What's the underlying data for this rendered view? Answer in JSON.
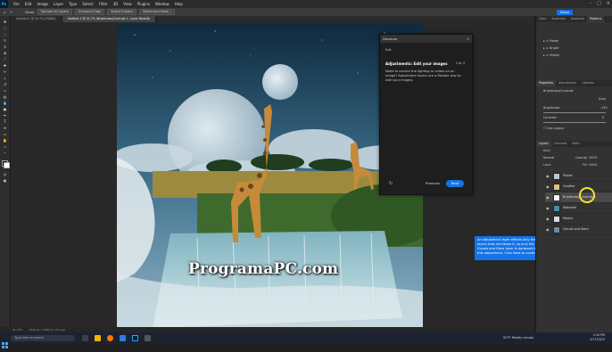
{
  "app": {
    "menu": [
      "File",
      "Edit",
      "Image",
      "Layer",
      "Type",
      "Select",
      "Filter",
      "3D",
      "View",
      "Plugins",
      "Window",
      "Help"
    ],
    "share_label": "Share",
    "options": [
      "Mode:",
      "Sample All Layers",
      "Enhance Edge",
      "Select Subject",
      "Select and Mask..."
    ]
  },
  "tabs": [
    {
      "label": "Untitled-1 @ 50.7% (RGB/8)"
    },
    {
      "label": "Untitled-1 @ 91.7% (Brightness/Contrast 1, Layer Mask/8)",
      "active": true
    }
  ],
  "canvas": {
    "watermark": "ProgramaPC.com"
  },
  "discover": {
    "header": "Discover",
    "exit": "Exit",
    "title": "Adjustments: Edit your images",
    "step": "4 of 4",
    "description": "Need to correct the lighting or colors on an image? Adjustment layers are a flexible way to edit your images.",
    "prev_label": "Previous",
    "next_label": "Next"
  },
  "tooltip": {
    "text": "An adjustment layer effects only the layers that are below it, so only the Clouds and Stars layer is darkened by this adjustment. Click Next to continue."
  },
  "panels": {
    "top_tabs": [
      "Color",
      "Swatches",
      "Gradients",
      "Patterns"
    ],
    "top_items": [
      "Pastel",
      "Bright",
      "Muted"
    ],
    "properties_tabs": [
      "Properties",
      "Adjustments",
      "Libraries"
    ],
    "properties_title": "Brightness/Contrast",
    "auto_label": "Auto",
    "brightness_label": "Brightness:",
    "brightness_value": "-150",
    "contrast_label": "Contrast:",
    "contrast_value": "0",
    "legacy_label": "Use Legacy",
    "layers_tabs": [
      "Layers",
      "Channels",
      "Paths"
    ],
    "kind_label": "Kind",
    "blend_mode": "Normal",
    "opacity_label": "Opacity: 100%",
    "lock_label": "Lock:",
    "fill_label": "Fill: 100%",
    "layers": [
      {
        "name": "Planet",
        "thumb": "#b9c7d6"
      },
      {
        "name": "Giraffes",
        "thumb": "#e0c080"
      },
      {
        "name": "Brightness/Contrast 1",
        "thumb": "#ffffff",
        "selected": true
      },
      {
        "name": "Waterfall",
        "thumb": "#4a90a0"
      },
      {
        "name": "Moons",
        "thumb": "#d0dde8"
      },
      {
        "name": "Clouds and Stars",
        "thumb": "#6a8aa8"
      }
    ]
  },
  "status": {
    "zoom": "91.74%",
    "doc": "1920 px x 1080 px (72 ppi)"
  },
  "taskbar": {
    "search_placeholder": "Type here to search",
    "weather": "55°F  Mostly cloudy",
    "time": "2:10 PM",
    "date": "2/17/2023"
  }
}
